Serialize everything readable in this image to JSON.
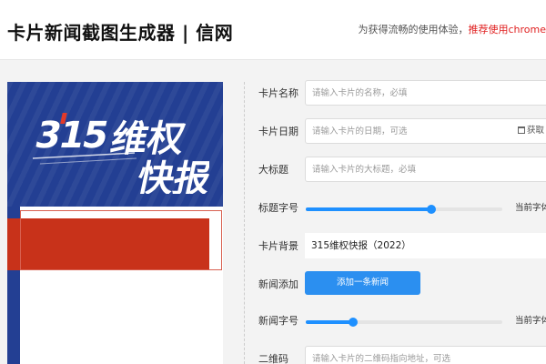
{
  "header": {
    "title": "卡片新闻截图生成器 | 信网",
    "notice_prefix": "为获得流畅的使用体验，",
    "notice_highlight": "推荐使用chrome"
  },
  "card": {
    "logo_text_number": "315",
    "logo_text_word1": "维权",
    "logo_text_word2": "快报",
    "colors": {
      "banner": "#233f93",
      "red": "#c8321a"
    }
  },
  "form": {
    "card_name": {
      "label": "卡片名称",
      "placeholder": "请输入卡片的名称，必填",
      "value": ""
    },
    "card_date": {
      "label": "卡片日期",
      "placeholder": "请输入卡片的日期，可选",
      "value": "",
      "suffix": "获取"
    },
    "headline": {
      "label": "大标题",
      "placeholder": "请输入卡片的大标题，必填",
      "value": ""
    },
    "title_font": {
      "label": "标题字号",
      "value": 0.64,
      "note": "当前字体"
    },
    "card_background": {
      "label": "卡片背景",
      "selected": "315维权快报（2022）"
    },
    "news_add": {
      "label": "新闻添加",
      "button_label": "添加一条新闻"
    },
    "news_font": {
      "label": "新闻字号",
      "value": 0.24,
      "note": "当前字体"
    },
    "qrcode": {
      "label": "二维码",
      "placeholder": "请输入卡片的二维码指向地址，可选",
      "value": ""
    }
  },
  "colors": {
    "accent": "#1e90ff",
    "highlight": "#e02020"
  }
}
